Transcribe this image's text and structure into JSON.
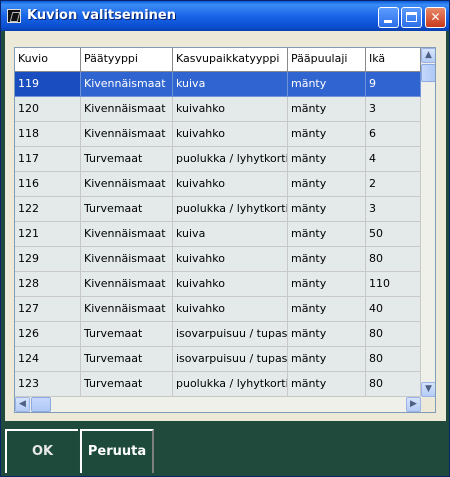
{
  "window": {
    "title": "Kuvion valitseminen"
  },
  "columns": [
    "Kuvio",
    "Päätyyppi",
    "Kasvupaikkatyyppi",
    "Pääpuulaji",
    "Ikä"
  ],
  "rows": [
    [
      "119",
      "Kivennäismaat",
      "kuiva",
      "mänty",
      "9"
    ],
    [
      "120",
      "Kivennäismaat",
      "kuivahko",
      "mänty",
      "3"
    ],
    [
      "118",
      "Kivennäismaat",
      "kuivahko",
      "mänty",
      "6"
    ],
    [
      "117",
      "Turvemaat",
      "puolukka / lyhytkortiner",
      "mänty",
      "4"
    ],
    [
      "116",
      "Kivennäismaat",
      "kuivahko",
      "mänty",
      "2"
    ],
    [
      "122",
      "Turvemaat",
      "puolukka / lyhytkortiner",
      "mänty",
      "3"
    ],
    [
      "121",
      "Kivennäismaat",
      "kuiva",
      "mänty",
      "50"
    ],
    [
      "129",
      "Kivennäismaat",
      "kuivahko",
      "mänty",
      "80"
    ],
    [
      "128",
      "Kivennäismaat",
      "kuivahko",
      "mänty",
      "110"
    ],
    [
      "127",
      "Kivennäismaat",
      "kuivahko",
      "mänty",
      "40"
    ],
    [
      "126",
      "Turvemaat",
      "isovarpuisuu / tupasvilla",
      "mänty",
      "80"
    ],
    [
      "124",
      "Turvemaat",
      "isovarpuisuu / tupasvilla",
      "mänty",
      "80"
    ],
    [
      "123",
      "Turvemaat",
      "puolukka / lyhytkortiner",
      "mänty",
      "80"
    ]
  ],
  "selected_row": 0,
  "buttons": {
    "ok": "OK",
    "cancel": "Peruuta"
  },
  "icons": {
    "app": "window-app-icon",
    "minimize": "minimize-icon",
    "maximize": "maximize-icon",
    "close": "close-icon"
  },
  "colors": {
    "accent": "#3064d0",
    "frame": "#1f4a3c",
    "row_bg": "#e4eaea"
  }
}
